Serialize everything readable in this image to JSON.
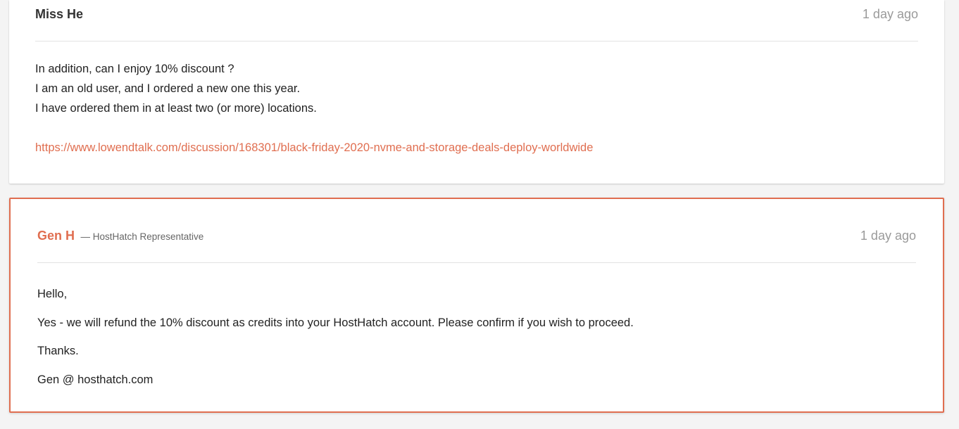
{
  "replies": [
    {
      "author": "Miss He",
      "time": "1 day ago",
      "lines": [
        "In addition, can I enjoy 10% discount ?",
        "I am an old user, and I ordered a new one this year.",
        "I have ordered them in at least two (or more) locations."
      ],
      "link": "https://www.lowendtalk.com/discussion/168301/black-friday-2020-nvme-and-storage-deals-deploy-worldwide"
    },
    {
      "author": "Gen H",
      "role": "— HostHatch Representative",
      "time": "1 day ago",
      "lines": [
        "Hello,",
        "Yes - we will refund the 10% discount as credits into your HostHatch account. Please confirm if you wish to proceed.",
        "Thanks.",
        "Gen @ hosthatch.com"
      ]
    }
  ],
  "colors": {
    "accent": "#e06e50",
    "muted": "#9a9a9a",
    "background": "#f4f4f4"
  }
}
